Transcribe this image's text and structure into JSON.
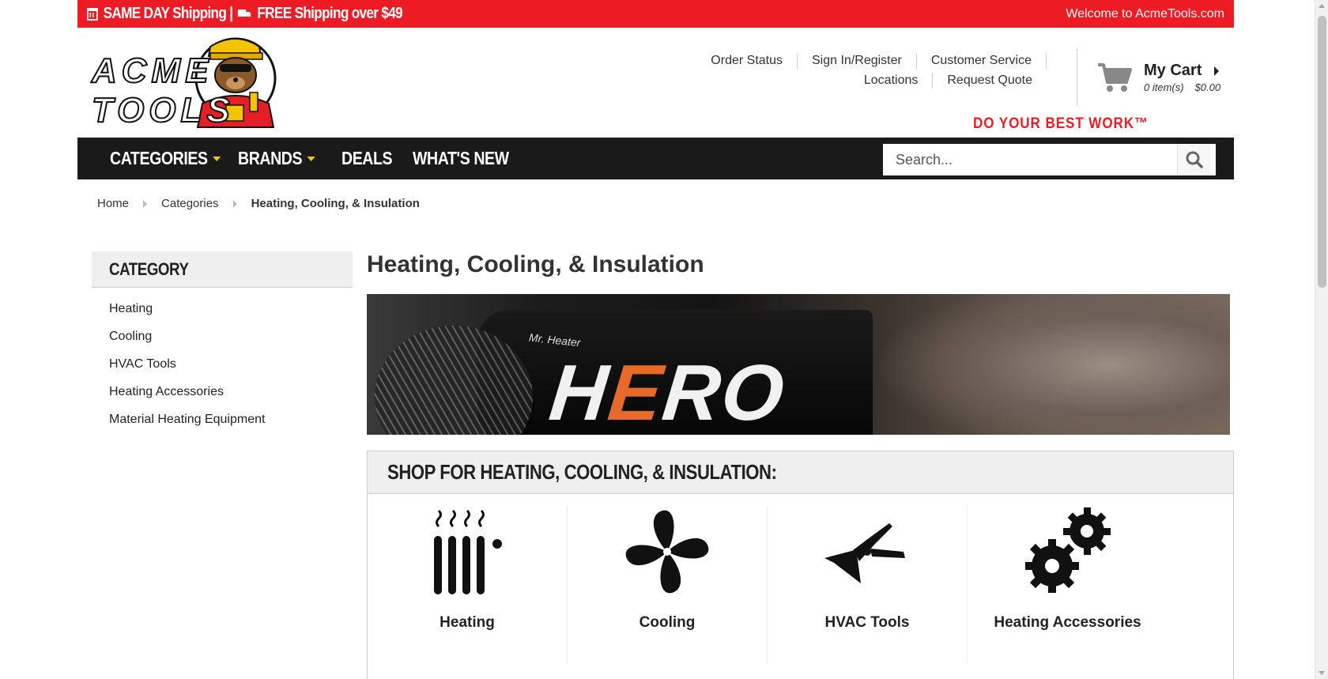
{
  "promo": {
    "left_text": "SAME DAY Shipping |",
    "free_text": "FREE Shipping over $49",
    "welcome": "Welcome to AcmeTools.com"
  },
  "brand": {
    "logo_text_a": "ACME",
    "logo_text_b": "TOOLS",
    "tagline": "DO YOUR BEST WORK™",
    "accent_color": "#ed1c24",
    "nav_bg": "#1a1a1a",
    "caret_color": "#f5c400"
  },
  "top_links": {
    "order_status": "Order Status",
    "sign_in": "Sign In/Register",
    "customer_service": "Customer Service",
    "locations": "Locations",
    "request_quote": "Request Quote"
  },
  "cart": {
    "title": "My Cart",
    "items": "0 item(s)",
    "total": "$0.00"
  },
  "nav": {
    "categories": "CATEGORIES",
    "brands": "BRANDS",
    "deals": "DEALS",
    "whats_new": "WHAT'S NEW",
    "search_placeholder": "Search..."
  },
  "breadcrumb": {
    "home": "Home",
    "categories": "Categories",
    "current": "Heating, Cooling, & Insulation"
  },
  "sidebar": {
    "heading": "CATEGORY",
    "items": [
      {
        "label": "Heating"
      },
      {
        "label": "Cooling"
      },
      {
        "label": "HVAC Tools"
      },
      {
        "label": "Heating Accessories"
      },
      {
        "label": "Material Heating Equipment"
      }
    ]
  },
  "main": {
    "title": "Heating, Cooling, & Insulation",
    "banner_word_a": "H",
    "banner_word_e": "E",
    "banner_word_b": "RO",
    "banner_small": "Mr. Heater",
    "shop_heading": "SHOP FOR HEATING, COOLING, & INSULATION:",
    "tiles": [
      {
        "label": "Heating",
        "icon": "radiator-icon"
      },
      {
        "label": "Cooling",
        "icon": "fan-icon"
      },
      {
        "label": "HVAC Tools",
        "icon": "hvac-tool-icon"
      },
      {
        "label": "Heating Accessories",
        "icon": "gears-icon"
      }
    ]
  }
}
